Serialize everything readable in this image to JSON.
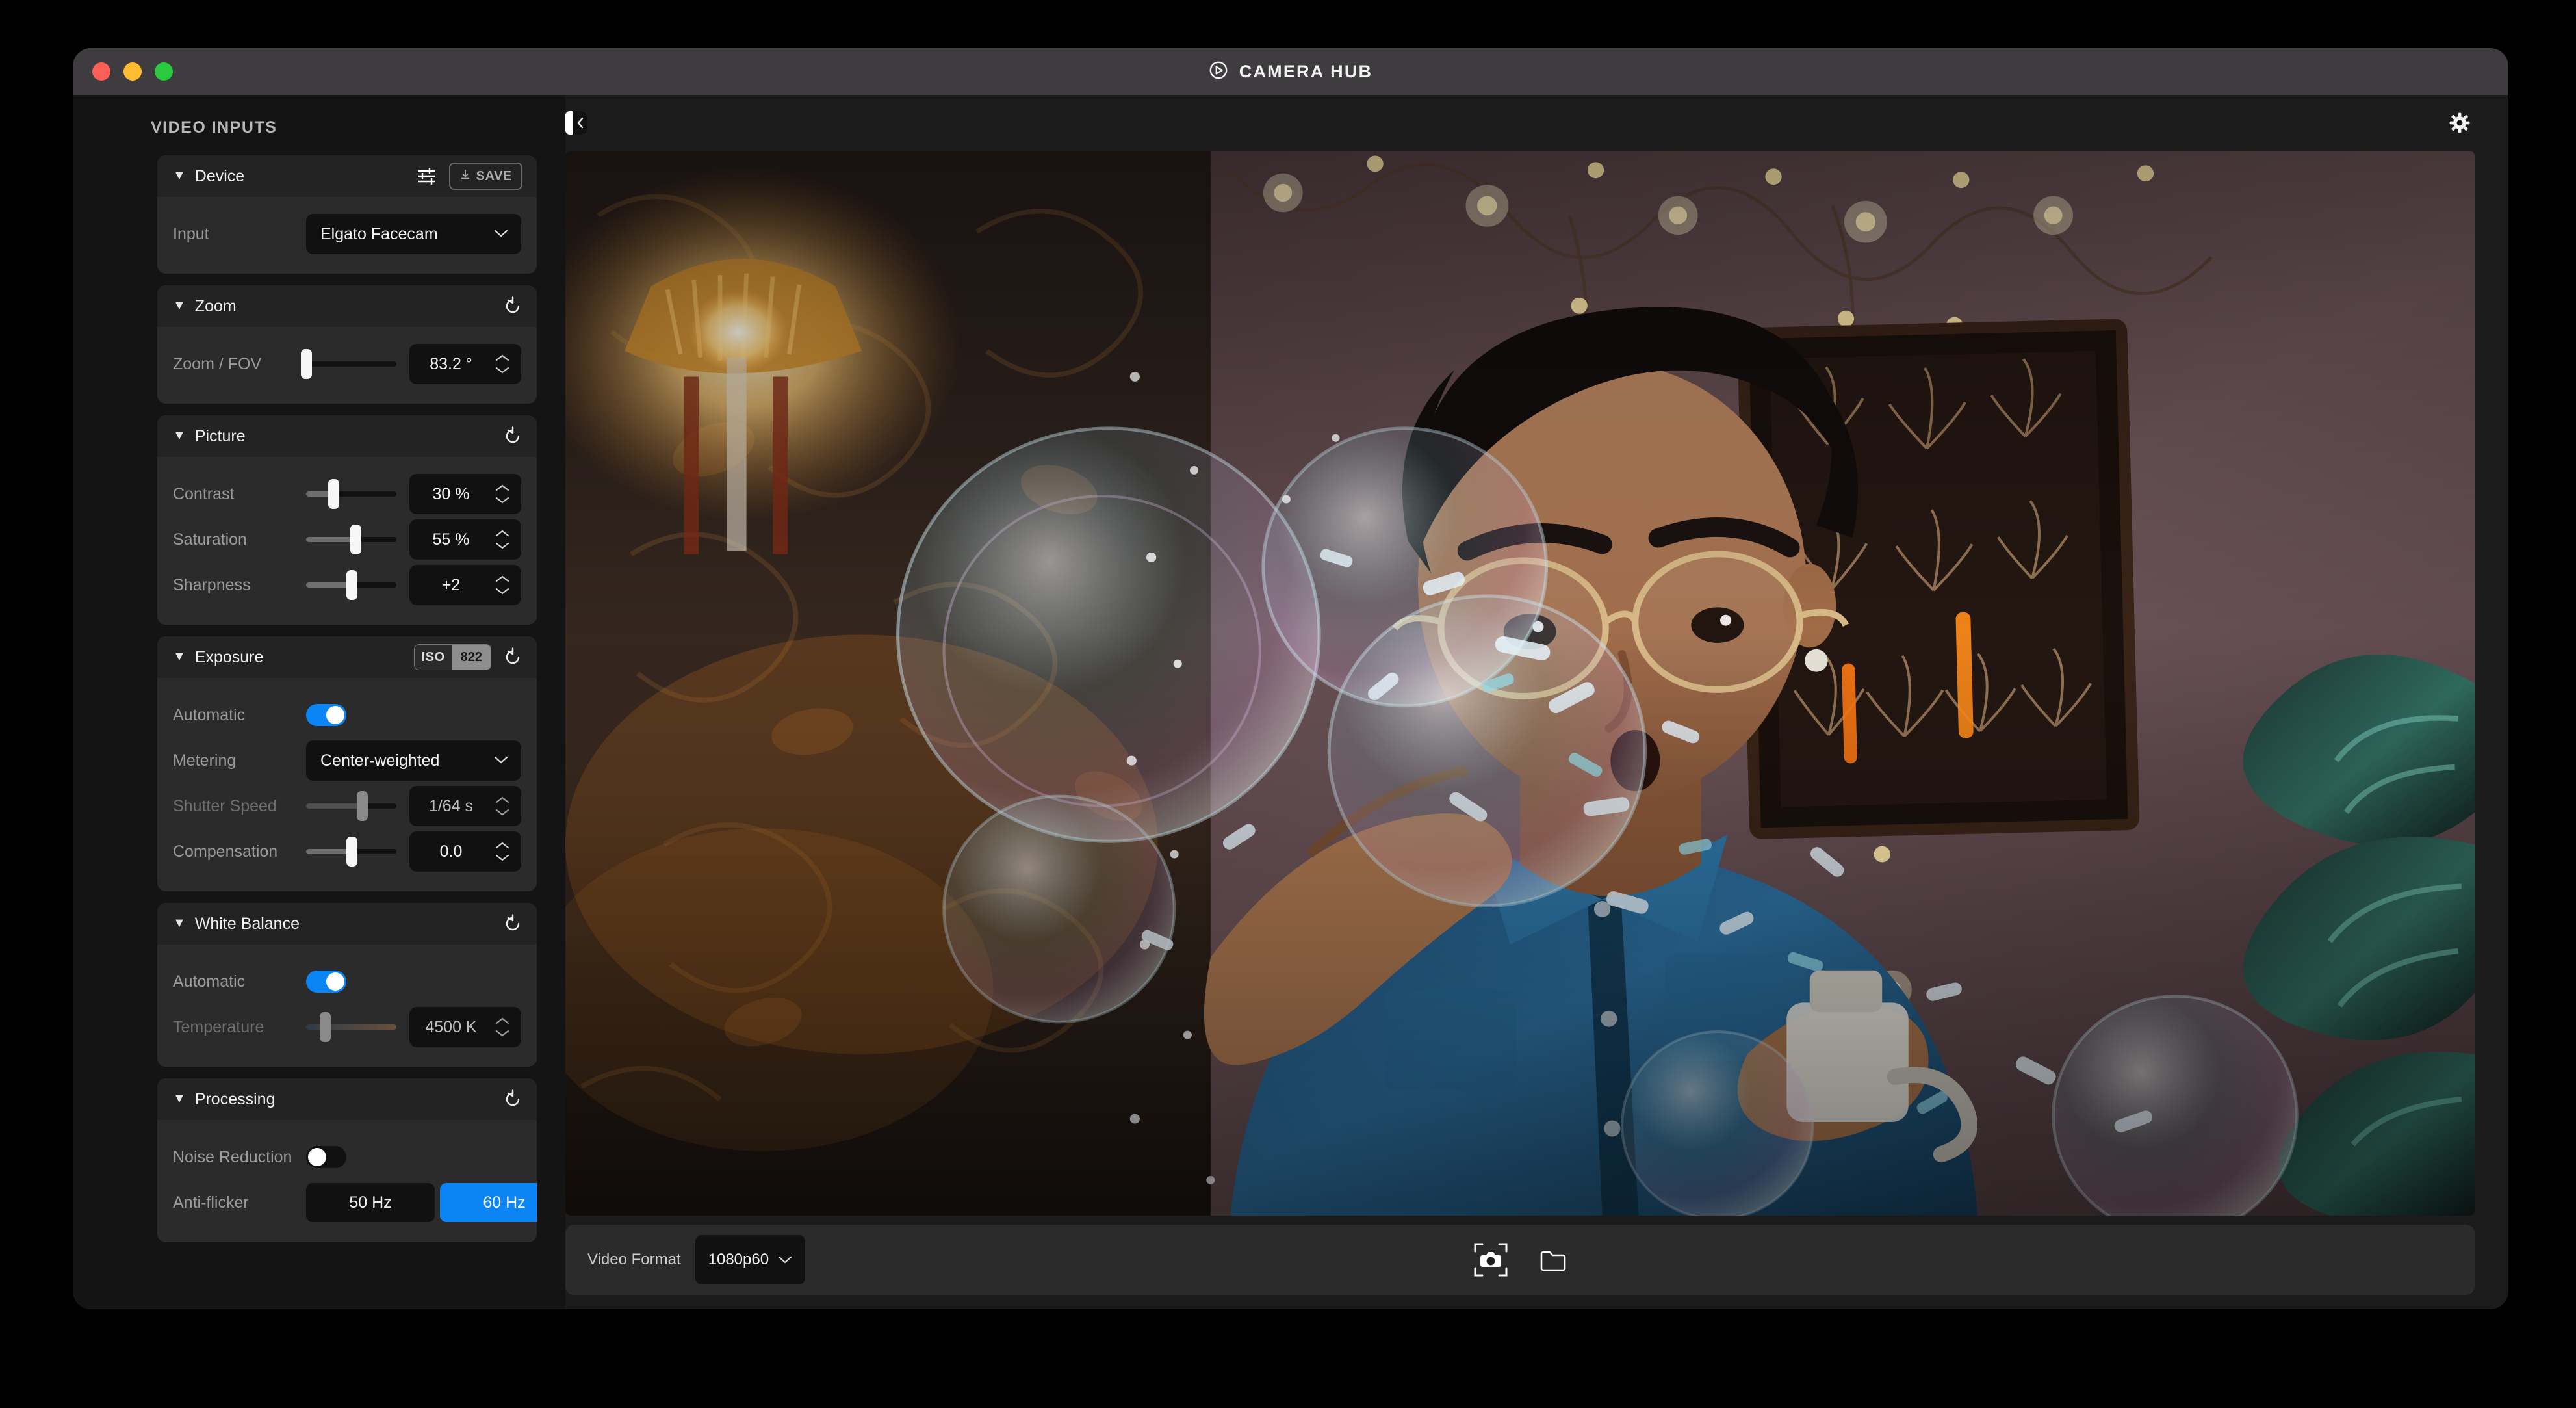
{
  "window": {
    "title": "CAMERA HUB",
    "logo_icon": "elgato-logo-icon",
    "traffic_lights": [
      "close",
      "minimize",
      "zoom"
    ],
    "settings_icon": "gear-icon"
  },
  "sidebar": {
    "title": "VIDEO INPUTS",
    "sections": [
      {
        "id": "device",
        "title": "Device",
        "caret": "▼",
        "header_icons": [
          "sliders-icon"
        ],
        "save_label": "SAVE",
        "rows": [
          {
            "label": "Input",
            "type": "select",
            "value": "Elgato Facecam"
          }
        ]
      },
      {
        "id": "zoom",
        "title": "Zoom",
        "caret": "▼",
        "reset_icon": "reset-icon",
        "rows": [
          {
            "label": "Zoom / FOV",
            "type": "slider",
            "value": "83.2 °",
            "pct": 0
          }
        ]
      },
      {
        "id": "picture",
        "title": "Picture",
        "caret": "▼",
        "reset_icon": "reset-icon",
        "rows": [
          {
            "label": "Contrast",
            "type": "slider",
            "value": "30 %",
            "pct": 30
          },
          {
            "label": "Saturation",
            "type": "slider",
            "value": "55 %",
            "pct": 55
          },
          {
            "label": "Sharpness",
            "type": "slider",
            "value": "+2",
            "pct": 50
          }
        ]
      },
      {
        "id": "exposure",
        "title": "Exposure",
        "caret": "▼",
        "reset_icon": "reset-icon",
        "badge": {
          "key": "ISO",
          "value": "822"
        },
        "rows": [
          {
            "label": "Automatic",
            "type": "toggle",
            "state": "on"
          },
          {
            "label": "Metering",
            "type": "select",
            "value": "Center-weighted"
          },
          {
            "label": "Shutter Speed",
            "type": "slider",
            "value": "1/64 s",
            "pct": 62,
            "disabled": true
          },
          {
            "label": "Compensation",
            "type": "slider",
            "value": "0.0",
            "pct": 50
          }
        ]
      },
      {
        "id": "white-balance",
        "title": "White Balance",
        "caret": "▼",
        "reset_icon": "reset-icon",
        "rows": [
          {
            "label": "Automatic",
            "type": "toggle",
            "state": "on"
          },
          {
            "label": "Temperature",
            "type": "slider",
            "value": "4500 K",
            "pct": 21,
            "disabled": true,
            "warm": true
          }
        ]
      },
      {
        "id": "processing",
        "title": "Processing",
        "caret": "▼",
        "reset_icon": "reset-icon",
        "rows": [
          {
            "label": "Noise Reduction",
            "type": "toggle",
            "state": "off"
          },
          {
            "label": "Anti-flicker",
            "type": "segmented",
            "options": [
              {
                "label": "50 Hz",
                "selected": false
              },
              {
                "label": "60 Hz",
                "selected": true
              }
            ]
          }
        ]
      }
    ]
  },
  "main": {
    "panel_toggle_icon": "collapse-sidebar-icon",
    "preview": {
      "alt": "Live camera preview: person in denim shirt blowing soap bubbles in a warmly lit room with fairy lights, a framed botanical print and a houseplant"
    },
    "bottom_bar": {
      "video_format_label": "Video Format",
      "video_format_value": "1080p60",
      "snapshot_icon": "camera-snapshot-icon",
      "folder_icon": "folder-icon"
    }
  },
  "colors": {
    "accent_blue": "#0b84f5",
    "window_bg": "#1b1b1b",
    "sidebar_bg": "#141414",
    "card_bg": "#2b2b2b",
    "card_head_bg": "#232323",
    "field_bg": "#111111",
    "titlebar_bg": "#3f3c3f",
    "text_primary": "#f0f0f0",
    "text_secondary": "#9a9a9a",
    "text_disabled": "#6e6e6e",
    "traffic_red": "#fd5f57",
    "traffic_yellow": "#febc2e",
    "traffic_green": "#29c940"
  }
}
